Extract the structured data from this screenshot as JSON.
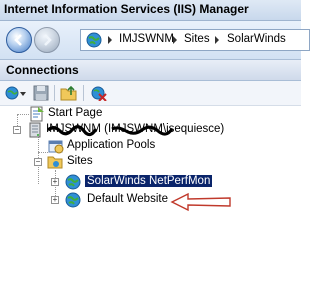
{
  "window": {
    "title": "Internet Information Services (IIS) Manager"
  },
  "address_bar": {
    "crumbs": [
      "IMJSWNM",
      "Sites",
      "SolarWinds"
    ]
  },
  "connections": {
    "header": "Connections",
    "tree": {
      "start_page": "Start Page",
      "server": "IMJSWNM (IMJSWNM\\jsequiesce)",
      "app_pools": "Application Pools",
      "sites": "Sites",
      "site_1": "SolarWinds NetPerfMon",
      "site_2": "Default Website"
    }
  },
  "colors": {
    "selection": "#0a246a",
    "arrow": "#c0392b"
  }
}
